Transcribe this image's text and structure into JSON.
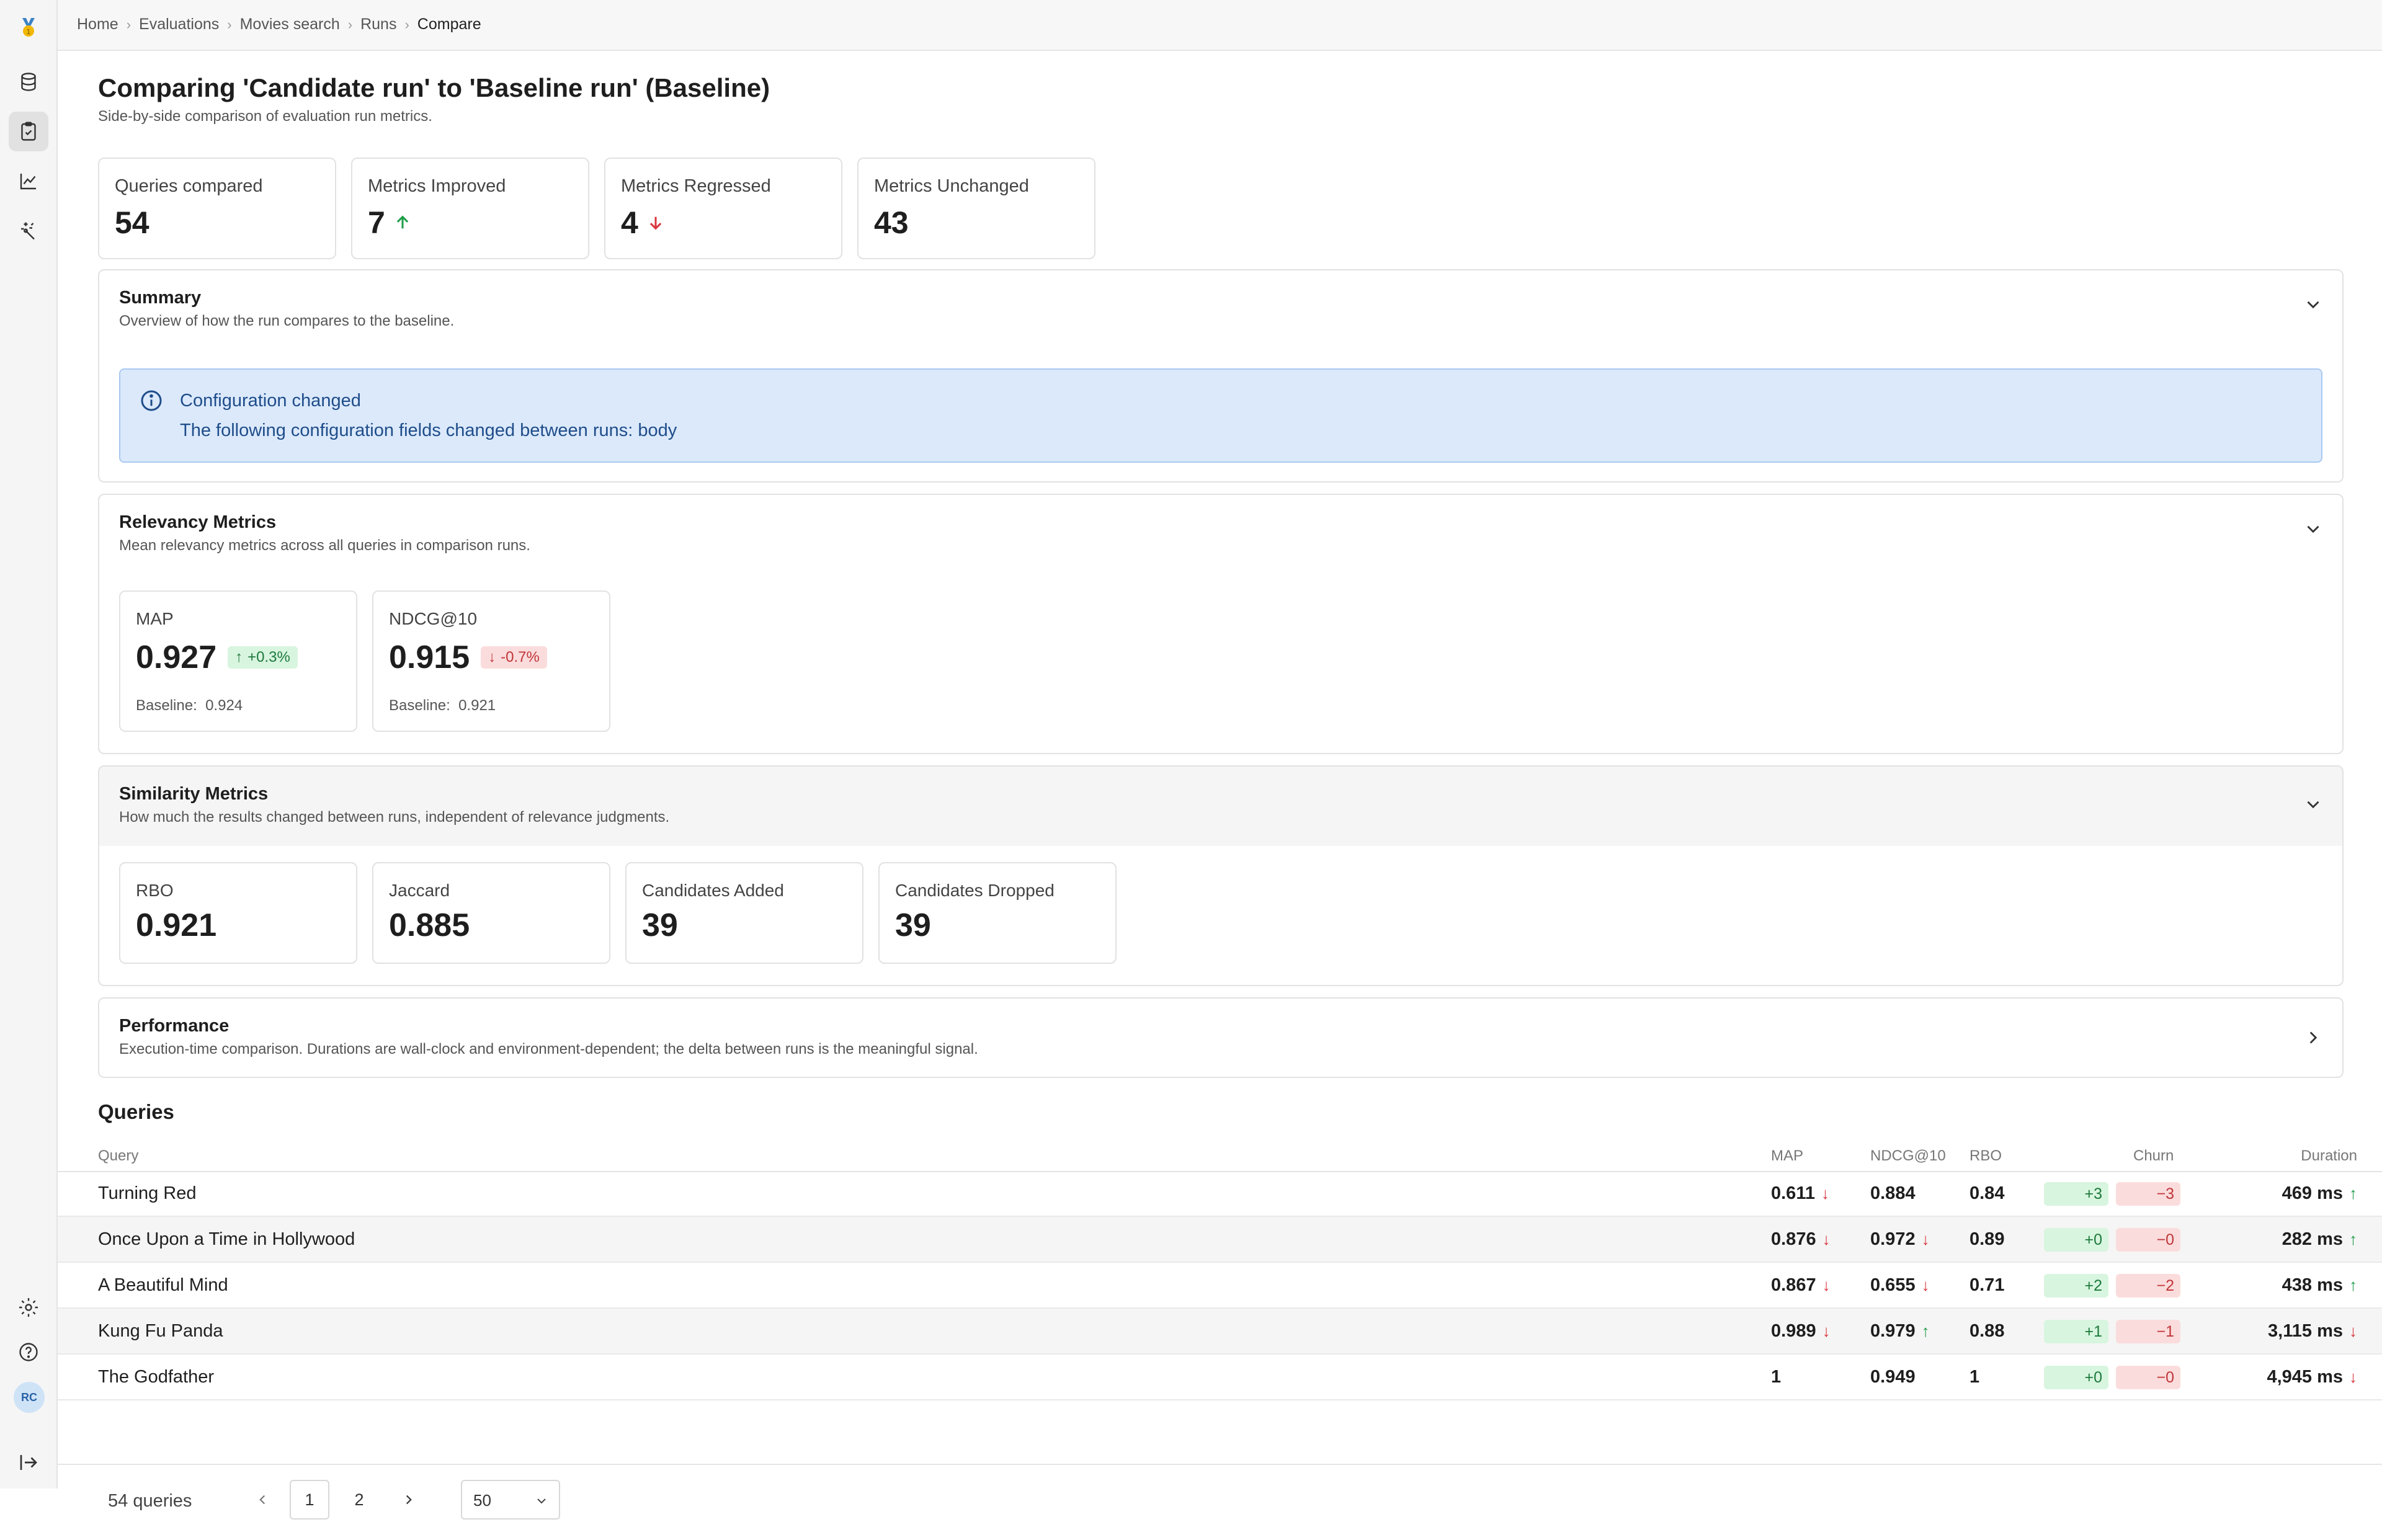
{
  "breadcrumb": [
    "Home",
    "Evaluations",
    "Movies search",
    "Runs",
    "Compare"
  ],
  "user": {
    "initials": "RC"
  },
  "page": {
    "title": "Comparing 'Candidate run' to 'Baseline run' (Baseline)",
    "subtitle": "Side-by-side comparison of evaluation run metrics."
  },
  "stats": [
    {
      "label": "Queries compared",
      "value": "54"
    },
    {
      "label": "Metrics Improved",
      "value": "7",
      "trend": "up"
    },
    {
      "label": "Metrics Regressed",
      "value": "4",
      "trend": "down"
    },
    {
      "label": "Metrics Unchanged",
      "value": "43"
    }
  ],
  "summary": {
    "title": "Summary",
    "description": "Overview of how the run compares to the baseline.",
    "alert_title": "Configuration changed",
    "alert_text": "The following configuration fields changed between runs: body"
  },
  "relevancy": {
    "title": "Relevancy Metrics",
    "description": "Mean relevancy metrics across all queries in comparison runs.",
    "cards": [
      {
        "label": "MAP",
        "value": "0.927",
        "delta": "+0.3%",
        "baseline_label": "Baseline:",
        "baseline": "0.924"
      },
      {
        "label": "NDCG@10",
        "value": "0.915",
        "delta": "-0.7%",
        "baseline_label": "Baseline:",
        "baseline": "0.921"
      }
    ]
  },
  "similarity": {
    "title": "Similarity Metrics",
    "description": "How much the results changed between runs, independent of relevance judgments.",
    "cards": [
      {
        "label": "RBO",
        "value": "0.921"
      },
      {
        "label": "Jaccard",
        "value": "0.885"
      },
      {
        "label": "Candidates Added",
        "value": "39"
      },
      {
        "label": "Candidates Dropped",
        "value": "39"
      }
    ]
  },
  "performance": {
    "title": "Performance",
    "description": "Execution-time comparison. Durations are wall-clock and environment-dependent; the delta between runs is the meaningful signal."
  },
  "queries": {
    "title": "Queries",
    "columns": {
      "query": "Query",
      "map": "MAP",
      "ndcg": "NDCG@10",
      "rbo": "RBO",
      "churn": "Churn",
      "duration": "Duration"
    },
    "rows": [
      {
        "query": "Turning Red",
        "map": "0.611",
        "map_trend": "down",
        "ndcg": "0.884",
        "ndcg_trend": "",
        "rbo": "0.84",
        "added": "+3",
        "dropped": "−3",
        "duration": "469 ms",
        "duration_trend": "up"
      },
      {
        "query": "Once Upon a Time in Hollywood",
        "map": "0.876",
        "map_trend": "down",
        "ndcg": "0.972",
        "ndcg_trend": "down",
        "rbo": "0.89",
        "added": "+0",
        "dropped": "−0",
        "duration": "282 ms",
        "duration_trend": "up"
      },
      {
        "query": "A Beautiful Mind",
        "map": "0.867",
        "map_trend": "down",
        "ndcg": "0.655",
        "ndcg_trend": "down",
        "rbo": "0.71",
        "added": "+2",
        "dropped": "−2",
        "duration": "438 ms",
        "duration_trend": "up"
      },
      {
        "query": "Kung Fu Panda",
        "map": "0.989",
        "map_trend": "down",
        "ndcg": "0.979",
        "ndcg_trend": "up",
        "rbo": "0.88",
        "added": "+1",
        "dropped": "−1",
        "duration": "3,115 ms",
        "duration_trend": "down"
      },
      {
        "query": "The Godfather",
        "map": "1",
        "map_trend": "",
        "ndcg": "0.949",
        "ndcg_trend": "",
        "rbo": "1",
        "added": "+0",
        "dropped": "−0",
        "duration": "4,945 ms",
        "duration_trend": "down"
      }
    ]
  },
  "pagination": {
    "count_text": "54 queries",
    "pages": [
      "1",
      "2"
    ],
    "current": "1",
    "page_size": "50"
  },
  "colors": {
    "improve": "#1f9d49",
    "regress": "#d9363e",
    "info_bg": "#dbe9fb"
  }
}
